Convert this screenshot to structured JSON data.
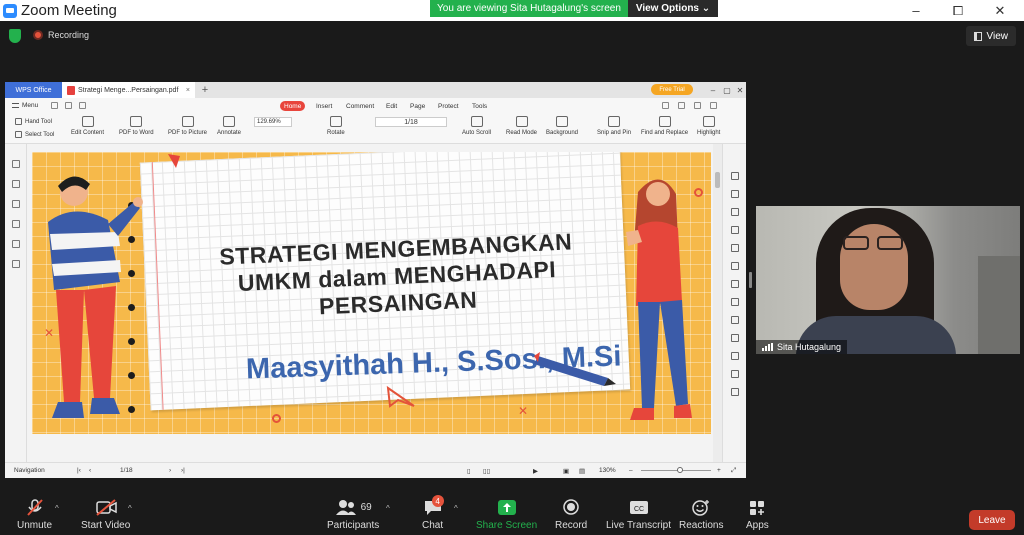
{
  "window": {
    "title": "Zoom Meeting",
    "minimize": "–",
    "maximize": "⧠",
    "close": "✕"
  },
  "banner": {
    "viewing": "You are viewing Sita Hutagalung's screen",
    "view_options": "View Options ⌄"
  },
  "header": {
    "recording": "Recording",
    "view": "View"
  },
  "wps": {
    "office_tab": "WPS Office",
    "doc_tab": "Strategi Menge...Persaingan.pdf",
    "free_trial": "Free Trial",
    "menu": "Menu",
    "menu_tabs": [
      "Home",
      "Insert",
      "Comment",
      "Edit",
      "Page",
      "Protect",
      "Tools"
    ],
    "hand_tool": "Hand Tool",
    "select_tool": "Select Tool",
    "ribbon": [
      "Edit Content",
      "PDF to Word",
      "PDF to Picture",
      "Annotate",
      "Rotate",
      "Auto Scroll",
      "Read Mode",
      "Background",
      "Snip and Pin",
      "Find and Replace",
      "Highlight"
    ],
    "zoom": "129.69%",
    "page": "1/18",
    "status": {
      "navigation": "Navigation",
      "page": "1/18",
      "zoom": "130%"
    }
  },
  "slide": {
    "title_lines": [
      "STRATEGI MENGEMBANGKAN",
      "UMKM dalam MENGHADAPI",
      "PERSAINGAN"
    ],
    "author": "Maasyithah H., S.Sos., M.Si"
  },
  "participant": {
    "name": "Sita Hutagalung"
  },
  "toolbar": {
    "unmute": "Unmute",
    "start_video": "Start Video",
    "participants": "Participants",
    "participants_count": "69",
    "chat": "Chat",
    "chat_badge": "4",
    "share": "Share Screen",
    "record": "Record",
    "transcript": "Live Transcript",
    "reactions": "Reactions",
    "apps": "Apps",
    "leave": "Leave"
  },
  "colors": {
    "share_green": "#23b14d",
    "leave_red": "#c33b2a",
    "wps_blue": "#3f6fd8",
    "wps_home_red": "#e8453c",
    "slide_orange": "#f6b94a",
    "author_blue": "#3c66ae"
  }
}
